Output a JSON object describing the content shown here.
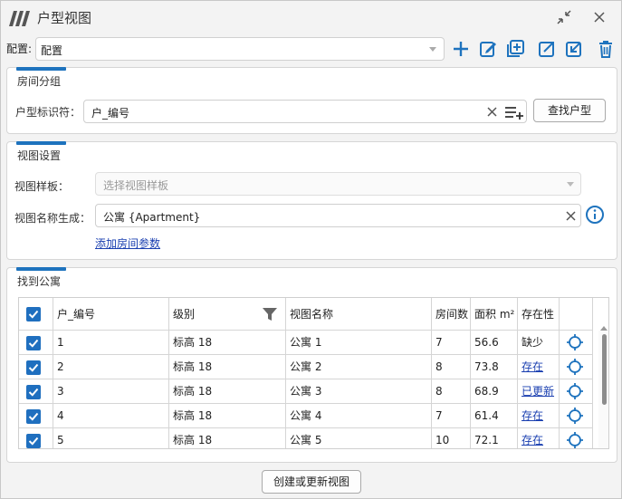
{
  "window": {
    "title": "户型视图",
    "icons": {
      "logo": "app-logo-icon",
      "minimize": "collapse-arrows-icon",
      "close": "close-icon"
    }
  },
  "config": {
    "label": "配置:",
    "selected": "配置",
    "toolbar_icons": [
      "add-icon",
      "edit-icon",
      "duplicate-icon",
      "export-icon",
      "import-icon",
      "delete-icon"
    ],
    "accent_color": "#1e73be"
  },
  "room_grouping": {
    "title": "房间分组",
    "identifier_label": "户型标识符：",
    "identifier_value": "户_编号",
    "find_button": "查找户型"
  },
  "view_settings": {
    "title": "视图设置",
    "template_label": "视图样板：",
    "template_placeholder": "选择视图样板",
    "name_label": "视图名称生成：",
    "name_value": "公寓 {Apartment}",
    "add_param_link": "添加房间参数"
  },
  "found": {
    "title": "找到公寓",
    "columns": [
      "户_编号",
      "级别",
      "视图名称",
      "房间数",
      "面积 m²",
      "存在性"
    ],
    "rows": [
      {
        "id": "1",
        "level": "标高 18",
        "view": "公寓 1",
        "rooms": "7",
        "area": "56.6",
        "status": "缺少",
        "status_link": false
      },
      {
        "id": "2",
        "level": "标高 18",
        "view": "公寓 2",
        "rooms": "8",
        "area": "73.8",
        "status": "存在",
        "status_link": true
      },
      {
        "id": "3",
        "level": "标高 18",
        "view": "公寓 3",
        "rooms": "8",
        "area": "68.9",
        "status": "已更新",
        "status_link": true
      },
      {
        "id": "4",
        "level": "标高 18",
        "view": "公寓 4",
        "rooms": "7",
        "area": "61.4",
        "status": "存在",
        "status_link": true
      },
      {
        "id": "5",
        "level": "标高 18",
        "view": "公寓 5",
        "rooms": "10",
        "area": "72.1",
        "status": "存在",
        "status_link": true
      }
    ]
  },
  "footer": {
    "create_button": "创建或更新视图"
  }
}
